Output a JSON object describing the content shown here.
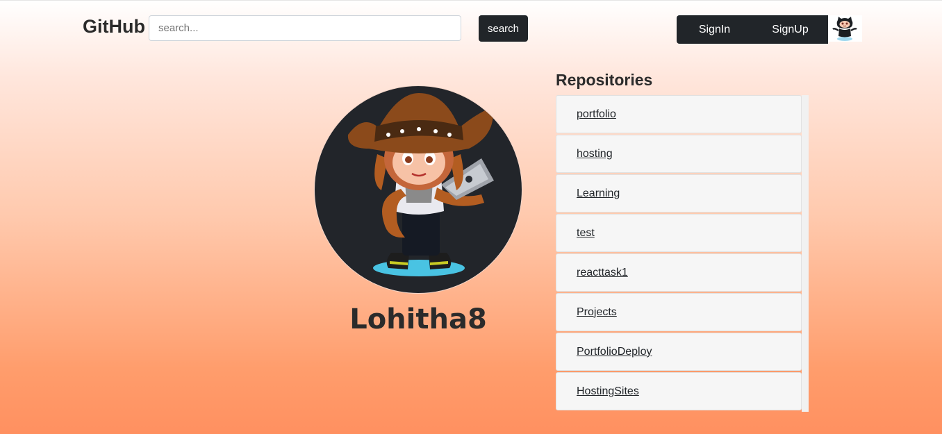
{
  "header": {
    "brand": "GitHub",
    "search_placeholder": "search...",
    "search_button": "search",
    "signin_label": "SignIn",
    "signup_label": "SignUp",
    "octocat_icon": "octocat-icon"
  },
  "profile": {
    "username": "Lohitha8",
    "avatar_icon": "octocat-cowgirl-avatar"
  },
  "repositories": {
    "title": "Repositories",
    "items": [
      {
        "name": "portfolio"
      },
      {
        "name": "hosting"
      },
      {
        "name": "Learning"
      },
      {
        "name": "test"
      },
      {
        "name": "reacttask1"
      },
      {
        "name": "Projects"
      },
      {
        "name": "PortfolioDeploy"
      },
      {
        "name": "HostingSites"
      }
    ]
  },
  "colors": {
    "dark": "#212529",
    "gradient_top": "#ffffff",
    "gradient_bottom": "#ff9060"
  }
}
